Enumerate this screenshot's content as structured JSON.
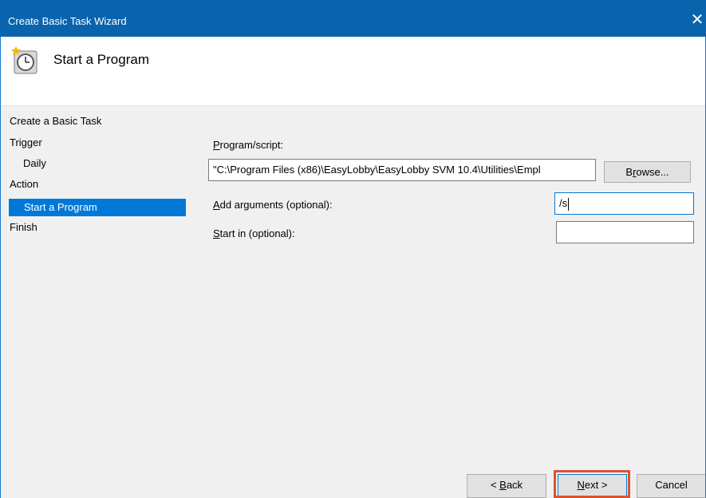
{
  "window": {
    "title": "Create Basic Task Wizard",
    "close_glyph": "✕"
  },
  "header": {
    "title": "Start a Program",
    "icon": "task-scheduler-clock-icon"
  },
  "steps": [
    {
      "label": "Create a Basic Task"
    },
    {
      "label": "Trigger"
    },
    {
      "label": "Daily"
    },
    {
      "label": "Action"
    },
    {
      "label": "Start a Program"
    },
    {
      "label": "Finish"
    }
  ],
  "form": {
    "program_label_mn": "P",
    "program_label_rest": "rogram/script:",
    "program_value": "\"C:\\Program Files (x86)\\EasyLobby\\EasyLobby SVM 10.4\\Utilities\\Empl",
    "browse_mn": "r",
    "browse_pre": "B",
    "browse_post": "owse...",
    "args_label_mn": "A",
    "args_label_rest": "dd arguments (optional):",
    "args_value": "/s",
    "startin_label_mn": "S",
    "startin_label_rest": "tart in (optional):",
    "startin_value": ""
  },
  "buttons": {
    "back_pre": "< ",
    "back_mn": "B",
    "back_post": "ack",
    "next_mn": "N",
    "next_post": "ext >",
    "cancel": "Cancel"
  },
  "colors": {
    "titlebar": "#0a64ad",
    "selection": "#0078d7",
    "highlight": "#e0522a"
  }
}
